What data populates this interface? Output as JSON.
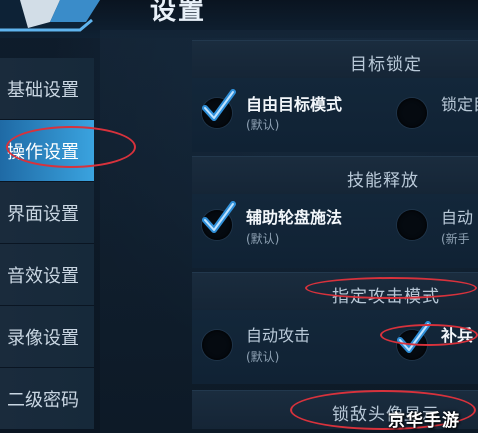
{
  "header": {
    "title": "设置"
  },
  "sidebar": {
    "items": [
      {
        "label": "基础设置",
        "active": false
      },
      {
        "label": "操作设置",
        "active": true
      },
      {
        "label": "界面设置",
        "active": false
      },
      {
        "label": "音效设置",
        "active": false
      },
      {
        "label": "录像设置",
        "active": false
      },
      {
        "label": "二级密码",
        "active": false
      }
    ]
  },
  "sections": [
    {
      "title": "目标锁定",
      "options": [
        {
          "label": "自由目标模式",
          "sub": "(默认)",
          "checked": true
        },
        {
          "label": "锁定目",
          "sub": "",
          "checked": false
        }
      ]
    },
    {
      "title": "技能释放",
      "options": [
        {
          "label": "辅助轮盘施法",
          "sub": "(默认)",
          "checked": true
        },
        {
          "label": "自动",
          "sub": "(新手",
          "checked": false
        }
      ]
    },
    {
      "title": "指定攻击模式",
      "options": [
        {
          "label": "自动攻击",
          "sub": "(默认)",
          "checked": false
        },
        {
          "label": "补兵",
          "sub": "",
          "checked": true
        }
      ]
    },
    {
      "title": "锁敌头像显示",
      "options": []
    }
  ],
  "watermark": "京华手游",
  "colors": {
    "accent": "#3aa3df",
    "check": "#2f8fd8",
    "annotation": "#d8323c"
  }
}
